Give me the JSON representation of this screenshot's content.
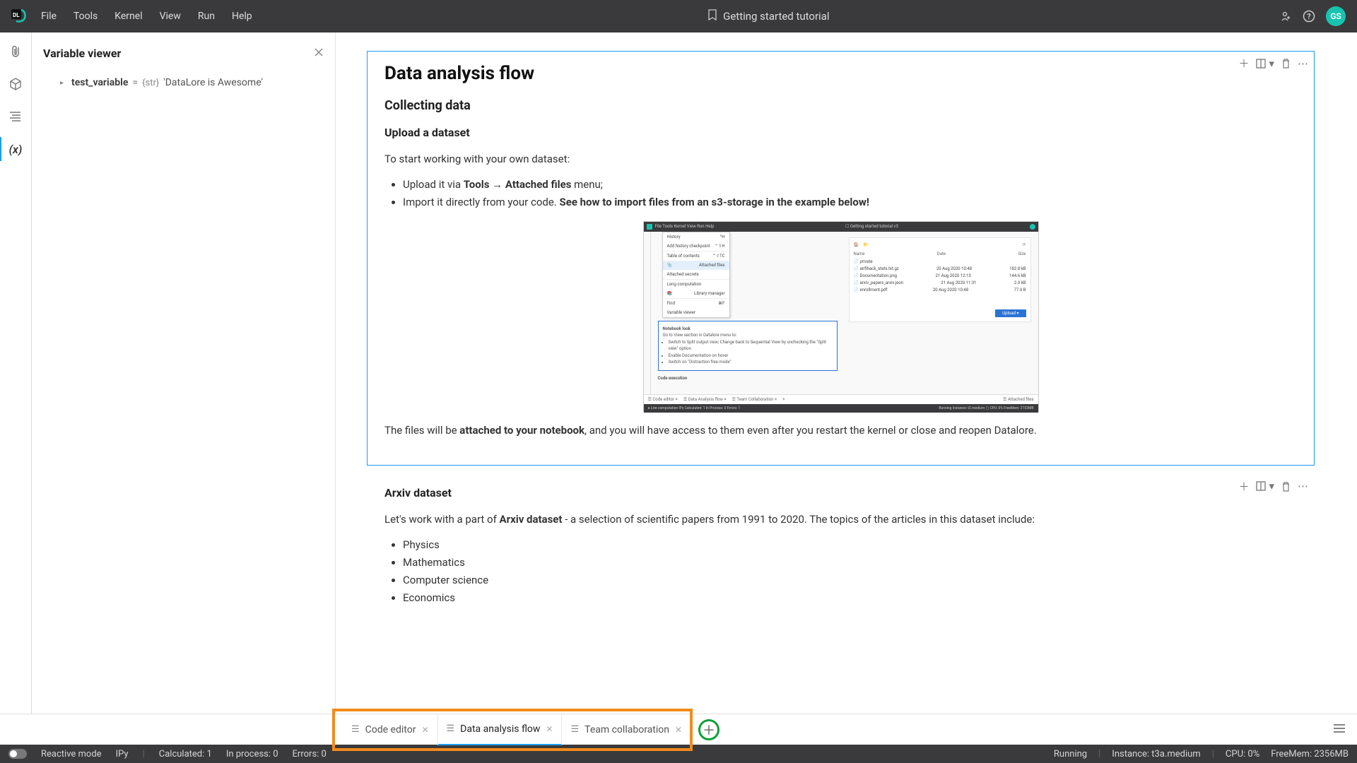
{
  "topbar": {
    "menu": [
      "File",
      "Tools",
      "Kernel",
      "View",
      "Run",
      "Help"
    ],
    "title": "Getting started tutorial",
    "avatar": "GS"
  },
  "panel": {
    "title": "Variable viewer",
    "var_name": "test_variable",
    "var_eq": "=",
    "var_type": "{str}",
    "var_value": "'DataLore is Awesome'"
  },
  "cell1": {
    "h1": "Data analysis flow",
    "h2": "Collecting data",
    "h3": "Upload a dataset",
    "p1": "To start working with your own dataset:",
    "li1a": "Upload it via ",
    "li1b": "Tools",
    "li1c": " → ",
    "li1d": "Attached files",
    "li1e": " menu;",
    "li2a": "Import it directly from your code. ",
    "li2b": "See how to import files from an s3-storage in the example below!",
    "p2a": "The files will be ",
    "p2b": "attached to your notebook",
    "p2c": ", and you will have access to them even after you restart the kernel or close and reopen Datalore."
  },
  "embedded": {
    "top_menu": "File   Tools   Kernel   View   Run   Help",
    "top_center": "☐ Getting started tutorial v3",
    "menu_items": [
      {
        "l": "History",
        "r": "^H"
      },
      {
        "l": "Add history checkpoint",
        "r": "⌃⇧H"
      },
      {
        "l": "Table of contents",
        "r": "⌃⇧TC"
      },
      {
        "l": "Attached files",
        "r": ""
      },
      {
        "l": "Attached secrets",
        "r": ""
      },
      {
        "l": "Long computation",
        "r": ""
      },
      {
        "l": "Library manager",
        "r": ""
      },
      {
        "l": "Find",
        "r": "⌘F"
      },
      {
        "l": "Variable viewer",
        "r": ""
      }
    ],
    "left_nb_title": "Notebook look",
    "left_goto": "Go to View section in Datalore menu to:",
    "left_b1": "Switch to Split output view; Change back to Sequential View by unchecking the \"Split view\" option",
    "left_b2": "Enable Documentation on hover",
    "left_b3": "Switch on \"Distraction free mode\"",
    "left_exec": "Code execution",
    "pane_name": "Name",
    "pane_date": "Date",
    "pane_size": "Size",
    "rows": [
      {
        "n": "private",
        "d": "",
        "s": ""
      },
      {
        "n": "airfiback_stats.txt.gz",
        "d": "20 Aug 2020 10:48",
        "s": "182.8 kB"
      },
      {
        "n": "Documentation.png",
        "d": "21 Aug 2020 12:13",
        "s": "144.6 kB"
      },
      {
        "n": "arxiv_papers_arxiv.json",
        "d": "21 Aug 2020 11:31",
        "s": "2.0 kB"
      },
      {
        "n": "enrollment.pdf",
        "d": "20 Aug 2020 10:48",
        "s": "77.0 B"
      }
    ],
    "upload": "Upload",
    "btabs": [
      "Code editor",
      "Data Analysis flow",
      "Team Collaboration"
    ],
    "btab_right": "Attached files",
    "status_l": "● Live computation     IPy     Calculated: 1     In Process: 0     Errors: 1",
    "status_r": "Running     Instance: t2.medium     ▢ CPU: 0%   FreeMem: 2153MB"
  },
  "cell2": {
    "h3": "Arxiv dataset",
    "p_a": "Let's work with a part of ",
    "p_b": "Arxiv dataset",
    "p_c": " - a selection of scientific papers from 1991 to 2020. The topics of the articles in this dataset include:",
    "topics": [
      "Physics",
      "Mathematics",
      "Computer science",
      "Economics"
    ]
  },
  "btabs": {
    "t1": "Code editor",
    "t2": "Data analysis flow",
    "t3": "Team collaboration"
  },
  "status": {
    "reactive": "Reactive mode",
    "ipy": "IPy",
    "calc": "Calculated: 1",
    "proc": "In process: 0",
    "err": "Errors: 0",
    "running": "Running",
    "instance": "Instance: t3a.medium",
    "cpu": "CPU:   0%",
    "mem": "FreeMem:   2356MB"
  }
}
